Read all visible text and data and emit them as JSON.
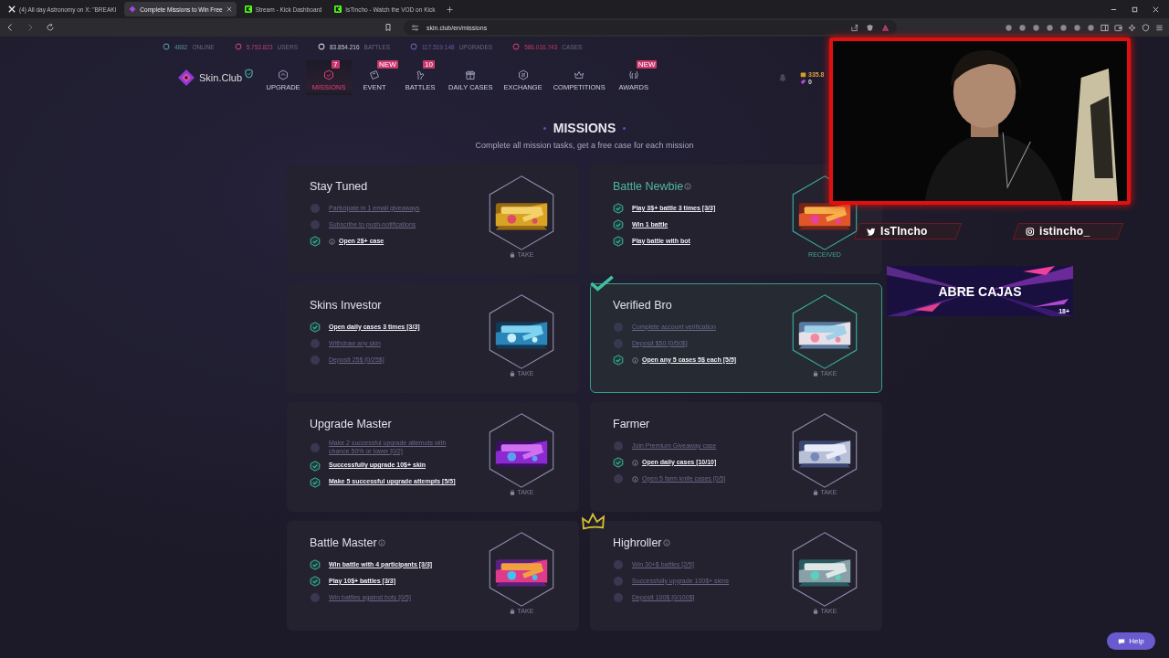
{
  "browser": {
    "tabs": [
      {
        "title": "(4) All day Astronomy on X: \"BREAKI",
        "kind": "x",
        "selected": false
      },
      {
        "title": "Complete Missions to Win Free",
        "kind": "skin",
        "selected": true
      },
      {
        "title": "Stream - Kick Dashboard",
        "kind": "kick",
        "selected": false
      },
      {
        "title": "IsTincho - Watch the VOD on Kick",
        "kind": "kick",
        "selected": false
      }
    ],
    "url": "skin.club/en/missions"
  },
  "stats": [
    {
      "value": "4882",
      "label": "ONLINE",
      "color": "#4f8a9c"
    },
    {
      "value": "5.753.823",
      "label": "USERS",
      "color": "#b8416b"
    },
    {
      "value": "83.854.216",
      "label": "BATTLES",
      "color": "#c9c9d9"
    },
    {
      "value": "117.519.148",
      "label": "UPGRADES",
      "color": "#6b5aa8"
    },
    {
      "value": "586.016.743",
      "label": "CASES",
      "color": "#c23a63"
    }
  ],
  "header": {
    "logo": "Skin.Club",
    "nav": [
      {
        "label": "UPGRADE",
        "selected": false
      },
      {
        "label": "MISSIONS",
        "selected": true,
        "badge": "7"
      },
      {
        "label": "EVENT",
        "selected": false,
        "badge": "NEW"
      },
      {
        "label": "BATTLES",
        "selected": false,
        "badge": "10"
      },
      {
        "label": "DAILY CASES",
        "selected": false
      },
      {
        "label": "EXCHANGE",
        "selected": false
      },
      {
        "label": "COMPETITIONS",
        "selected": false
      },
      {
        "label": "AWARDS",
        "selected": false,
        "badge": "NEW"
      }
    ],
    "balance": "335.8",
    "coins": "0"
  },
  "missions": {
    "title": "MISSIONS",
    "subtitle": "Complete all mission tasks, get a free case for each mission",
    "cards": [
      {
        "title": "Stay Tuned",
        "title_info": false,
        "highlighted": false,
        "received": false,
        "claim": "TAKE",
        "tasks": [
          {
            "text": "Participate in 1 email giveaways",
            "done": false,
            "info": false
          },
          {
            "text": "Subscribe to push-notifications",
            "done": false,
            "info": false
          },
          {
            "text": "Open 2$+ case",
            "done": true,
            "info": true
          }
        ]
      },
      {
        "title": "Battle Newbie",
        "title_info": true,
        "highlighted": false,
        "received": true,
        "claim": "RECEIVED",
        "tasks": [
          {
            "text": "Play 3$+ battle 3 times [3/3]",
            "done": true,
            "info": false
          },
          {
            "text": "Win 1 battle",
            "done": true,
            "info": false
          },
          {
            "text": "Play battle with bot",
            "done": true,
            "info": false
          }
        ]
      },
      {
        "title": "Skins Investor",
        "title_info": false,
        "highlighted": false,
        "received": false,
        "claim": "TAKE",
        "tasks": [
          {
            "text": "Open daily cases 3 times [3/3]",
            "done": true,
            "info": false
          },
          {
            "text": "Withdraw any skin",
            "done": false,
            "info": false
          },
          {
            "text": "Deposit 25$ [0/25$]",
            "done": false,
            "info": false
          }
        ]
      },
      {
        "title": "Verified Bro",
        "title_info": false,
        "highlighted": true,
        "received": false,
        "claim": "TAKE",
        "tasks": [
          {
            "text": "Complete account verification",
            "done": false,
            "info": false
          },
          {
            "text": "Deposit $50 [0/50$]",
            "done": false,
            "info": false
          },
          {
            "text": "Open any 5 cases 5$ each [5/5]",
            "done": true,
            "info": true
          }
        ]
      },
      {
        "title": "Upgrade Master",
        "title_info": false,
        "highlighted": false,
        "received": false,
        "claim": "TAKE",
        "tasks": [
          {
            "text": "Make 2 successful upgrade attemots with chance 50% or lower [0/2]",
            "done": false,
            "info": false
          },
          {
            "text": "Successfully upgrade 10$+ skin",
            "done": true,
            "info": false
          },
          {
            "text": "Make 5 successful upgrade attempts [5/5]",
            "done": true,
            "info": false
          }
        ]
      },
      {
        "title": "Farmer",
        "title_info": false,
        "highlighted": false,
        "received": false,
        "claim": "TAKE",
        "tasks": [
          {
            "text": "Join Premium Giveaway case",
            "done": false,
            "info": false
          },
          {
            "text": "Open daily cases [10/10]",
            "done": true,
            "info": true
          },
          {
            "text": "Open 5 farm knife cases [0/5]",
            "done": false,
            "info": true
          }
        ]
      },
      {
        "title": "Battle Master",
        "title_info": true,
        "highlighted": false,
        "received": false,
        "claim": "TAKE",
        "tasks": [
          {
            "text": "Win battle with 4 participants [3/3]",
            "done": true,
            "info": false
          },
          {
            "text": "Play 10$+ battles [3/3]",
            "done": true,
            "info": false
          },
          {
            "text": "Win battles against bots [0/5]",
            "done": false,
            "info": false
          }
        ]
      },
      {
        "title": "Highroller",
        "title_info": true,
        "highlighted": false,
        "received": false,
        "claim": "TAKE",
        "tasks": [
          {
            "text": "Win 30+$ battles [2/5]",
            "done": false,
            "info": false
          },
          {
            "text": "Successfully upgrade 100$+ skins",
            "done": false,
            "info": false
          },
          {
            "text": "Deposit 100$ [0/100$]",
            "done": false,
            "info": false
          }
        ]
      }
    ]
  },
  "stream": {
    "socials": [
      {
        "kind": "twitter",
        "handle": "IsTIncho"
      },
      {
        "kind": "instagram",
        "handle": "istincho_"
      }
    ],
    "banner": {
      "text": "ABRE CAJAS",
      "age": "18+"
    }
  },
  "help": "Help"
}
